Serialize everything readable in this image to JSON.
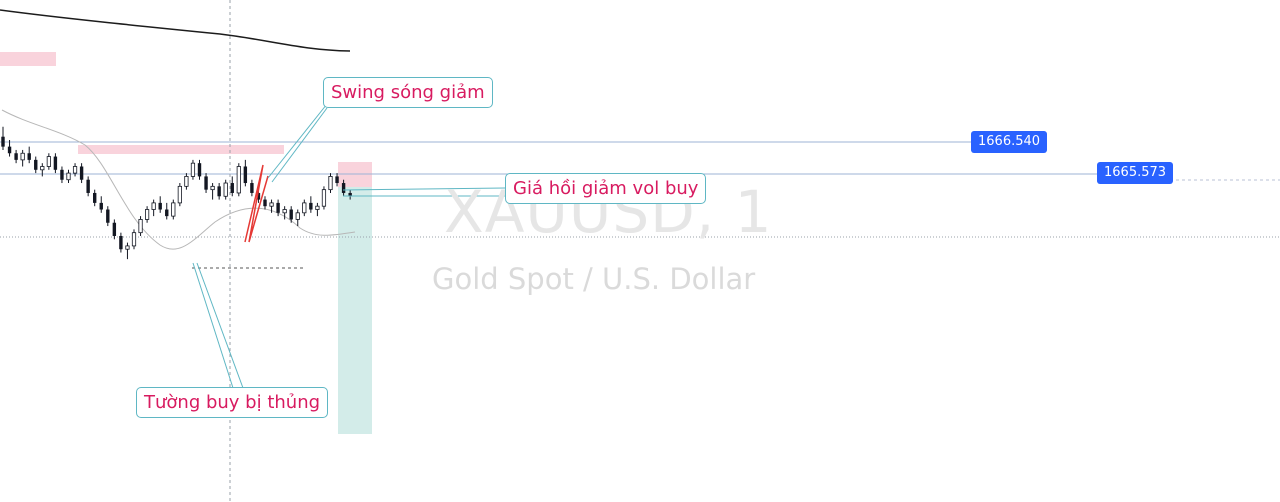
{
  "watermark": {
    "symbol": "XAUUSD, 1",
    "description": "Gold Spot / U.S. Dollar"
  },
  "price_tags": {
    "upper": "1666.540",
    "lower": "1665.573"
  },
  "annotations": {
    "swing": "Swing sóng giảm",
    "pullback": "Giá hồi giảm vol buy",
    "wall": "Tường buy bị thủng"
  },
  "colors": {
    "price_tag": "#2962ff",
    "annotation_text": "#d81b60",
    "annotation_border": "#5fb7c4",
    "zone_pink": "#f9d3dc",
    "zone_teal": "#d3ece9",
    "candle": "#131722"
  },
  "chart_data": {
    "type": "candlestick",
    "symbol": "XAUUSD",
    "timeframe": "1",
    "horizontal_lines": [
      1666.54,
      1665.573
    ],
    "candles_ohlc": [
      [
        1666.7,
        1667.0,
        1666.3,
        1666.4
      ],
      [
        1666.4,
        1666.6,
        1666.1,
        1666.2
      ],
      [
        1666.2,
        1666.3,
        1665.9,
        1666.0
      ],
      [
        1666.0,
        1666.3,
        1665.8,
        1666.2
      ],
      [
        1666.2,
        1666.4,
        1665.9,
        1666.0
      ],
      [
        1666.0,
        1666.1,
        1665.6,
        1665.7
      ],
      [
        1665.7,
        1665.9,
        1665.5,
        1665.8
      ],
      [
        1665.8,
        1666.2,
        1665.7,
        1666.1
      ],
      [
        1666.1,
        1666.2,
        1665.6,
        1665.7
      ],
      [
        1665.7,
        1665.8,
        1665.3,
        1665.4
      ],
      [
        1665.4,
        1665.7,
        1665.3,
        1665.6
      ],
      [
        1665.6,
        1665.9,
        1665.5,
        1665.8
      ],
      [
        1665.8,
        1665.9,
        1665.3,
        1665.4
      ],
      [
        1665.4,
        1665.5,
        1664.9,
        1665.0
      ],
      [
        1665.0,
        1665.1,
        1664.6,
        1664.7
      ],
      [
        1664.7,
        1664.9,
        1664.4,
        1664.5
      ],
      [
        1664.5,
        1664.6,
        1664.0,
        1664.1
      ],
      [
        1664.1,
        1664.2,
        1663.6,
        1663.7
      ],
      [
        1663.7,
        1663.8,
        1663.2,
        1663.3
      ],
      [
        1663.3,
        1663.5,
        1663.0,
        1663.4
      ],
      [
        1663.4,
        1663.9,
        1663.3,
        1663.8
      ],
      [
        1663.8,
        1664.3,
        1663.7,
        1664.2
      ],
      [
        1664.2,
        1664.6,
        1664.1,
        1664.5
      ],
      [
        1664.5,
        1664.8,
        1664.3,
        1664.7
      ],
      [
        1664.7,
        1664.9,
        1664.4,
        1664.5
      ],
      [
        1664.5,
        1664.7,
        1664.2,
        1664.3
      ],
      [
        1664.3,
        1664.8,
        1664.2,
        1664.7
      ],
      [
        1664.7,
        1665.3,
        1664.6,
        1665.2
      ],
      [
        1665.2,
        1665.6,
        1665.1,
        1665.5
      ],
      [
        1665.5,
        1666.0,
        1665.4,
        1665.9
      ],
      [
        1665.9,
        1666.0,
        1665.4,
        1665.5
      ],
      [
        1665.5,
        1665.6,
        1665.0,
        1665.1
      ],
      [
        1665.1,
        1665.3,
        1664.8,
        1665.2
      ],
      [
        1665.2,
        1665.3,
        1664.8,
        1664.9
      ],
      [
        1664.9,
        1665.4,
        1664.8,
        1665.3
      ],
      [
        1665.3,
        1665.5,
        1664.9,
        1665.0
      ],
      [
        1665.0,
        1665.9,
        1664.9,
        1665.8
      ],
      [
        1665.8,
        1666.0,
        1665.2,
        1665.3
      ],
      [
        1665.3,
        1665.4,
        1664.9,
        1665.0
      ],
      [
        1665.0,
        1665.1,
        1664.7,
        1664.8
      ],
      [
        1664.8,
        1664.9,
        1664.5,
        1664.6
      ],
      [
        1664.6,
        1664.8,
        1664.4,
        1664.7
      ],
      [
        1664.7,
        1664.8,
        1664.3,
        1664.4
      ],
      [
        1664.4,
        1664.6,
        1664.2,
        1664.5
      ],
      [
        1664.5,
        1664.6,
        1664.1,
        1664.2
      ],
      [
        1664.2,
        1664.5,
        1664.0,
        1664.4
      ],
      [
        1664.4,
        1664.8,
        1664.3,
        1664.7
      ],
      [
        1664.7,
        1664.9,
        1664.4,
        1664.5
      ],
      [
        1664.5,
        1664.7,
        1664.3,
        1664.6
      ],
      [
        1664.6,
        1665.2,
        1664.5,
        1665.1
      ],
      [
        1665.1,
        1665.6,
        1665.0,
        1665.5
      ],
      [
        1665.5,
        1665.6,
        1665.2,
        1665.3
      ],
      [
        1665.3,
        1665.4,
        1664.9,
        1665.0
      ],
      [
        1665.0,
        1665.1,
        1664.8,
        1664.9
      ]
    ]
  }
}
